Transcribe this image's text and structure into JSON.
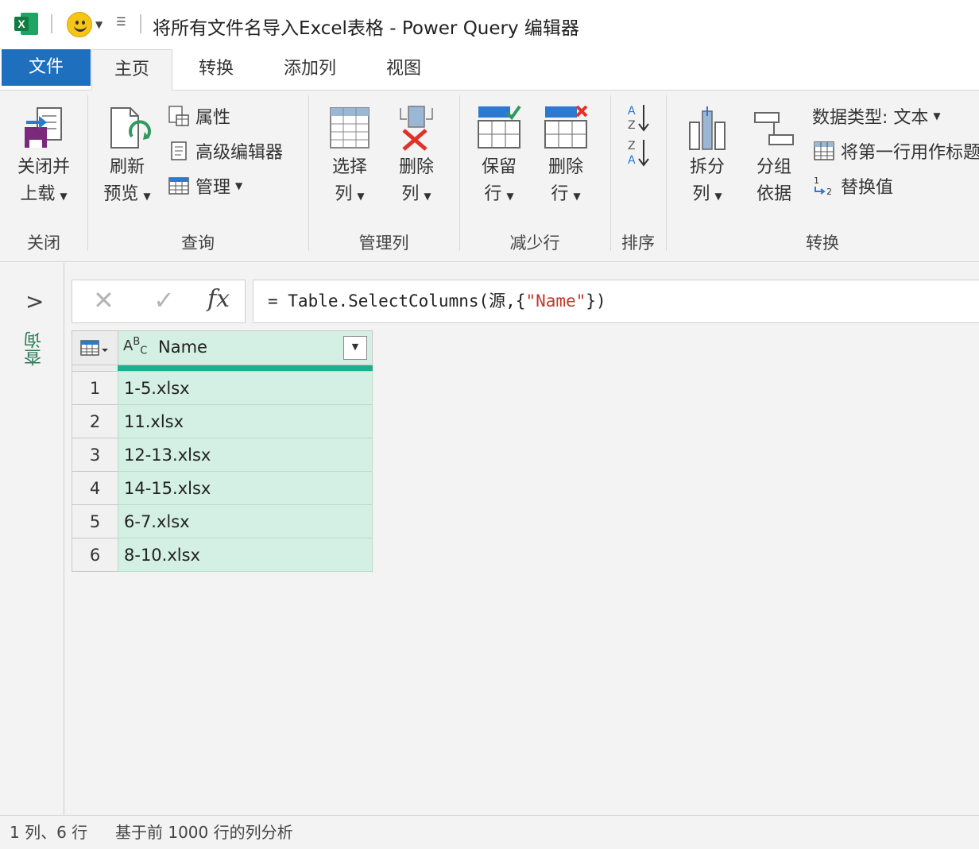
{
  "window": {
    "title": "将所有文件名导入Excel表格 - Power Query 编辑器"
  },
  "tabs": [
    {
      "label": "文件"
    },
    {
      "label": "主页"
    },
    {
      "label": "转换"
    },
    {
      "label": "添加列"
    },
    {
      "label": "视图"
    }
  ],
  "ribbon": {
    "close": {
      "label": "关闭",
      "close_load_line1": "关闭并",
      "close_load_line2": "上载"
    },
    "query": {
      "label": "查询",
      "refresh_line1": "刷新",
      "refresh_line2": "预览",
      "properties": "属性",
      "advanced_editor": "高级编辑器",
      "manage": "管理"
    },
    "manage_columns": {
      "label": "管理列",
      "choose_line1": "选择",
      "choose_line2": "列",
      "remove_line1": "删除",
      "remove_line2": "列"
    },
    "reduce_rows": {
      "label": "减少行",
      "keep_line1": "保留",
      "keep_line2": "行",
      "remove_line1": "删除",
      "remove_line2": "行"
    },
    "sort": {
      "label": "排序"
    },
    "transform": {
      "label": "转换",
      "split_line1": "拆分",
      "split_line2": "列",
      "group_line1": "分组",
      "group_line2": "依据",
      "data_type": "数据类型: 文本",
      "first_row_header": "将第一行用作标题",
      "replace_values": "替换值"
    }
  },
  "queries_pane": {
    "label": "查询"
  },
  "formula": {
    "prefix": "= Table.SelectColumns(源,{",
    "string": "\"Name\"",
    "suffix": "})"
  },
  "table": {
    "column_type": "ABC",
    "column_name": "Name",
    "rows": [
      {
        "index": "1",
        "value": "1-5.xlsx"
      },
      {
        "index": "2",
        "value": "11.xlsx"
      },
      {
        "index": "3",
        "value": "12-13.xlsx"
      },
      {
        "index": "4",
        "value": "14-15.xlsx"
      },
      {
        "index": "5",
        "value": "6-7.xlsx"
      },
      {
        "index": "6",
        "value": "8-10.xlsx"
      }
    ]
  },
  "status": {
    "counts": "1 列、6 行",
    "profiling": "基于前 1000 行的列分析"
  },
  "colors": {
    "file_tab": "#1f6fbf",
    "column_fill": "#d4efe3",
    "quality_bar": "#1aaf8f",
    "queries_label": "#2f7d5c"
  }
}
